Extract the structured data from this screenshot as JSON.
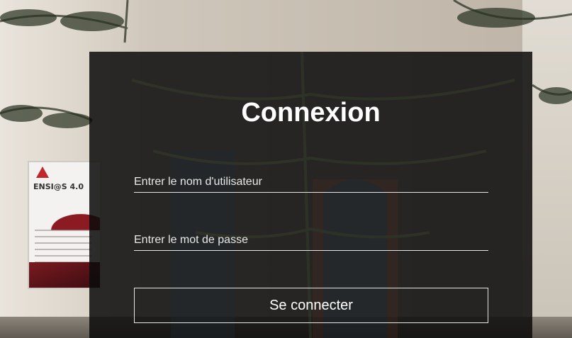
{
  "background": {
    "poster_title": "ENSI@S 4.0",
    "description_colors": {
      "wall": "#ddd6cb",
      "poster_accent": "#8b1a22"
    }
  },
  "login": {
    "title": "Connexion",
    "username_placeholder": "Entrer le nom d'utilisateur",
    "password_placeholder": "Entrer le mot de passe",
    "submit_label": "Se connecter"
  },
  "colors": {
    "panel": "#0c0c0c",
    "text": "#ffffff",
    "underline": "#e6e6e6"
  }
}
